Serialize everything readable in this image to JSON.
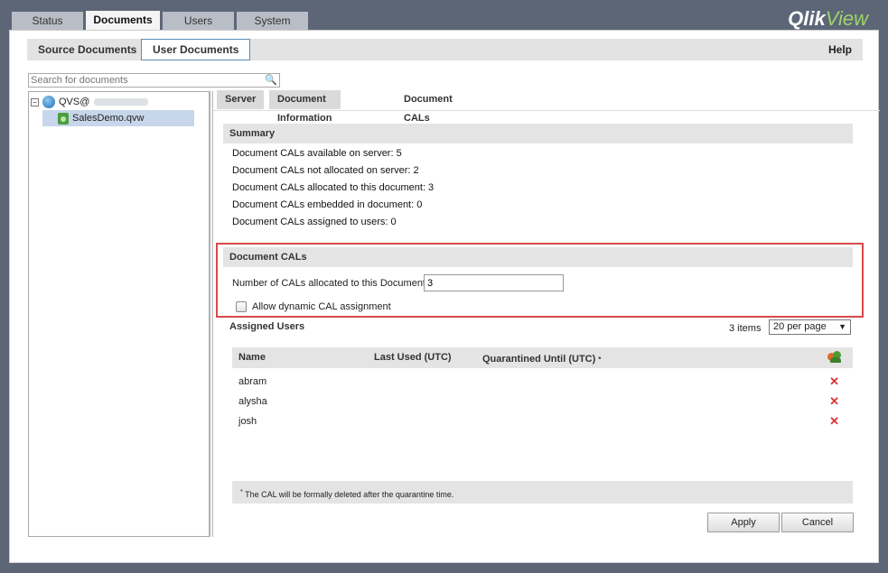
{
  "top_tabs": [
    "Status",
    "Documents",
    "Users",
    "System"
  ],
  "brand": {
    "part1": "Qlik",
    "part2": "View"
  },
  "subnav": {
    "source_docs": "Source Documents",
    "user_docs": "User Documents",
    "help": "Help"
  },
  "search": {
    "placeholder": "Search for documents",
    "value": ""
  },
  "tree": {
    "root_label": "QVS@",
    "doc_label": "SalesDemo.qvw"
  },
  "detail_tabs": [
    "Server",
    "Document Information",
    "Document CALs"
  ],
  "summary": {
    "title": "Summary",
    "lines": [
      "Document CALs available on server: 5",
      "Document CALs not allocated on server: 2",
      "Document CALs allocated to this document: 3",
      "Document CALs embedded in document: 0",
      "Document CALs assigned to users: 0"
    ]
  },
  "doc_cals": {
    "title": "Document CALs",
    "num_label": "Number of CALs allocated to this Document:",
    "num_value": "3",
    "dynamic_label": "Allow dynamic CAL assignment"
  },
  "assigned": {
    "title": "Assigned Users",
    "items_count": "3 items",
    "per_page": "20 per page",
    "columns": {
      "name": "Name",
      "last_used": "Last Used (UTC)",
      "quarantined": "Quarantined Until (UTC)",
      "asterisk": "*"
    },
    "users": [
      "abram",
      "alysha",
      "josh"
    ]
  },
  "note": {
    "asterisk": "*",
    "text": "The CAL will be formally deleted after the quarantine time."
  },
  "buttons": {
    "apply": "Apply",
    "cancel": "Cancel"
  }
}
